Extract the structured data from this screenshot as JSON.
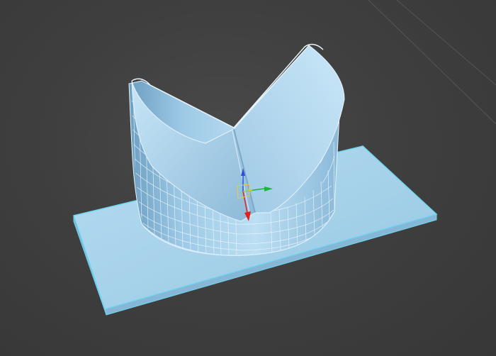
{
  "viewport": {
    "background_color": "#3d3d3d",
    "grid_line_color": "#5a5a5a"
  },
  "scene": {
    "objects": [
      {
        "name": "plane-base",
        "type": "box",
        "color": "#a8d2ea",
        "edge_color": "#6fd6f0"
      },
      {
        "name": "wedge-cylinder",
        "type": "editable-mesh",
        "color": "#a9d3ec",
        "wire_color": "#e8f4fb",
        "selected": true
      }
    ]
  },
  "gizmo": {
    "x_color": "#e0201e",
    "y_color": "#1fb53a",
    "z_color": "#2b4fe0",
    "plane_color": "#e8d03a",
    "icon": "move-transform-gizmo-icon"
  }
}
